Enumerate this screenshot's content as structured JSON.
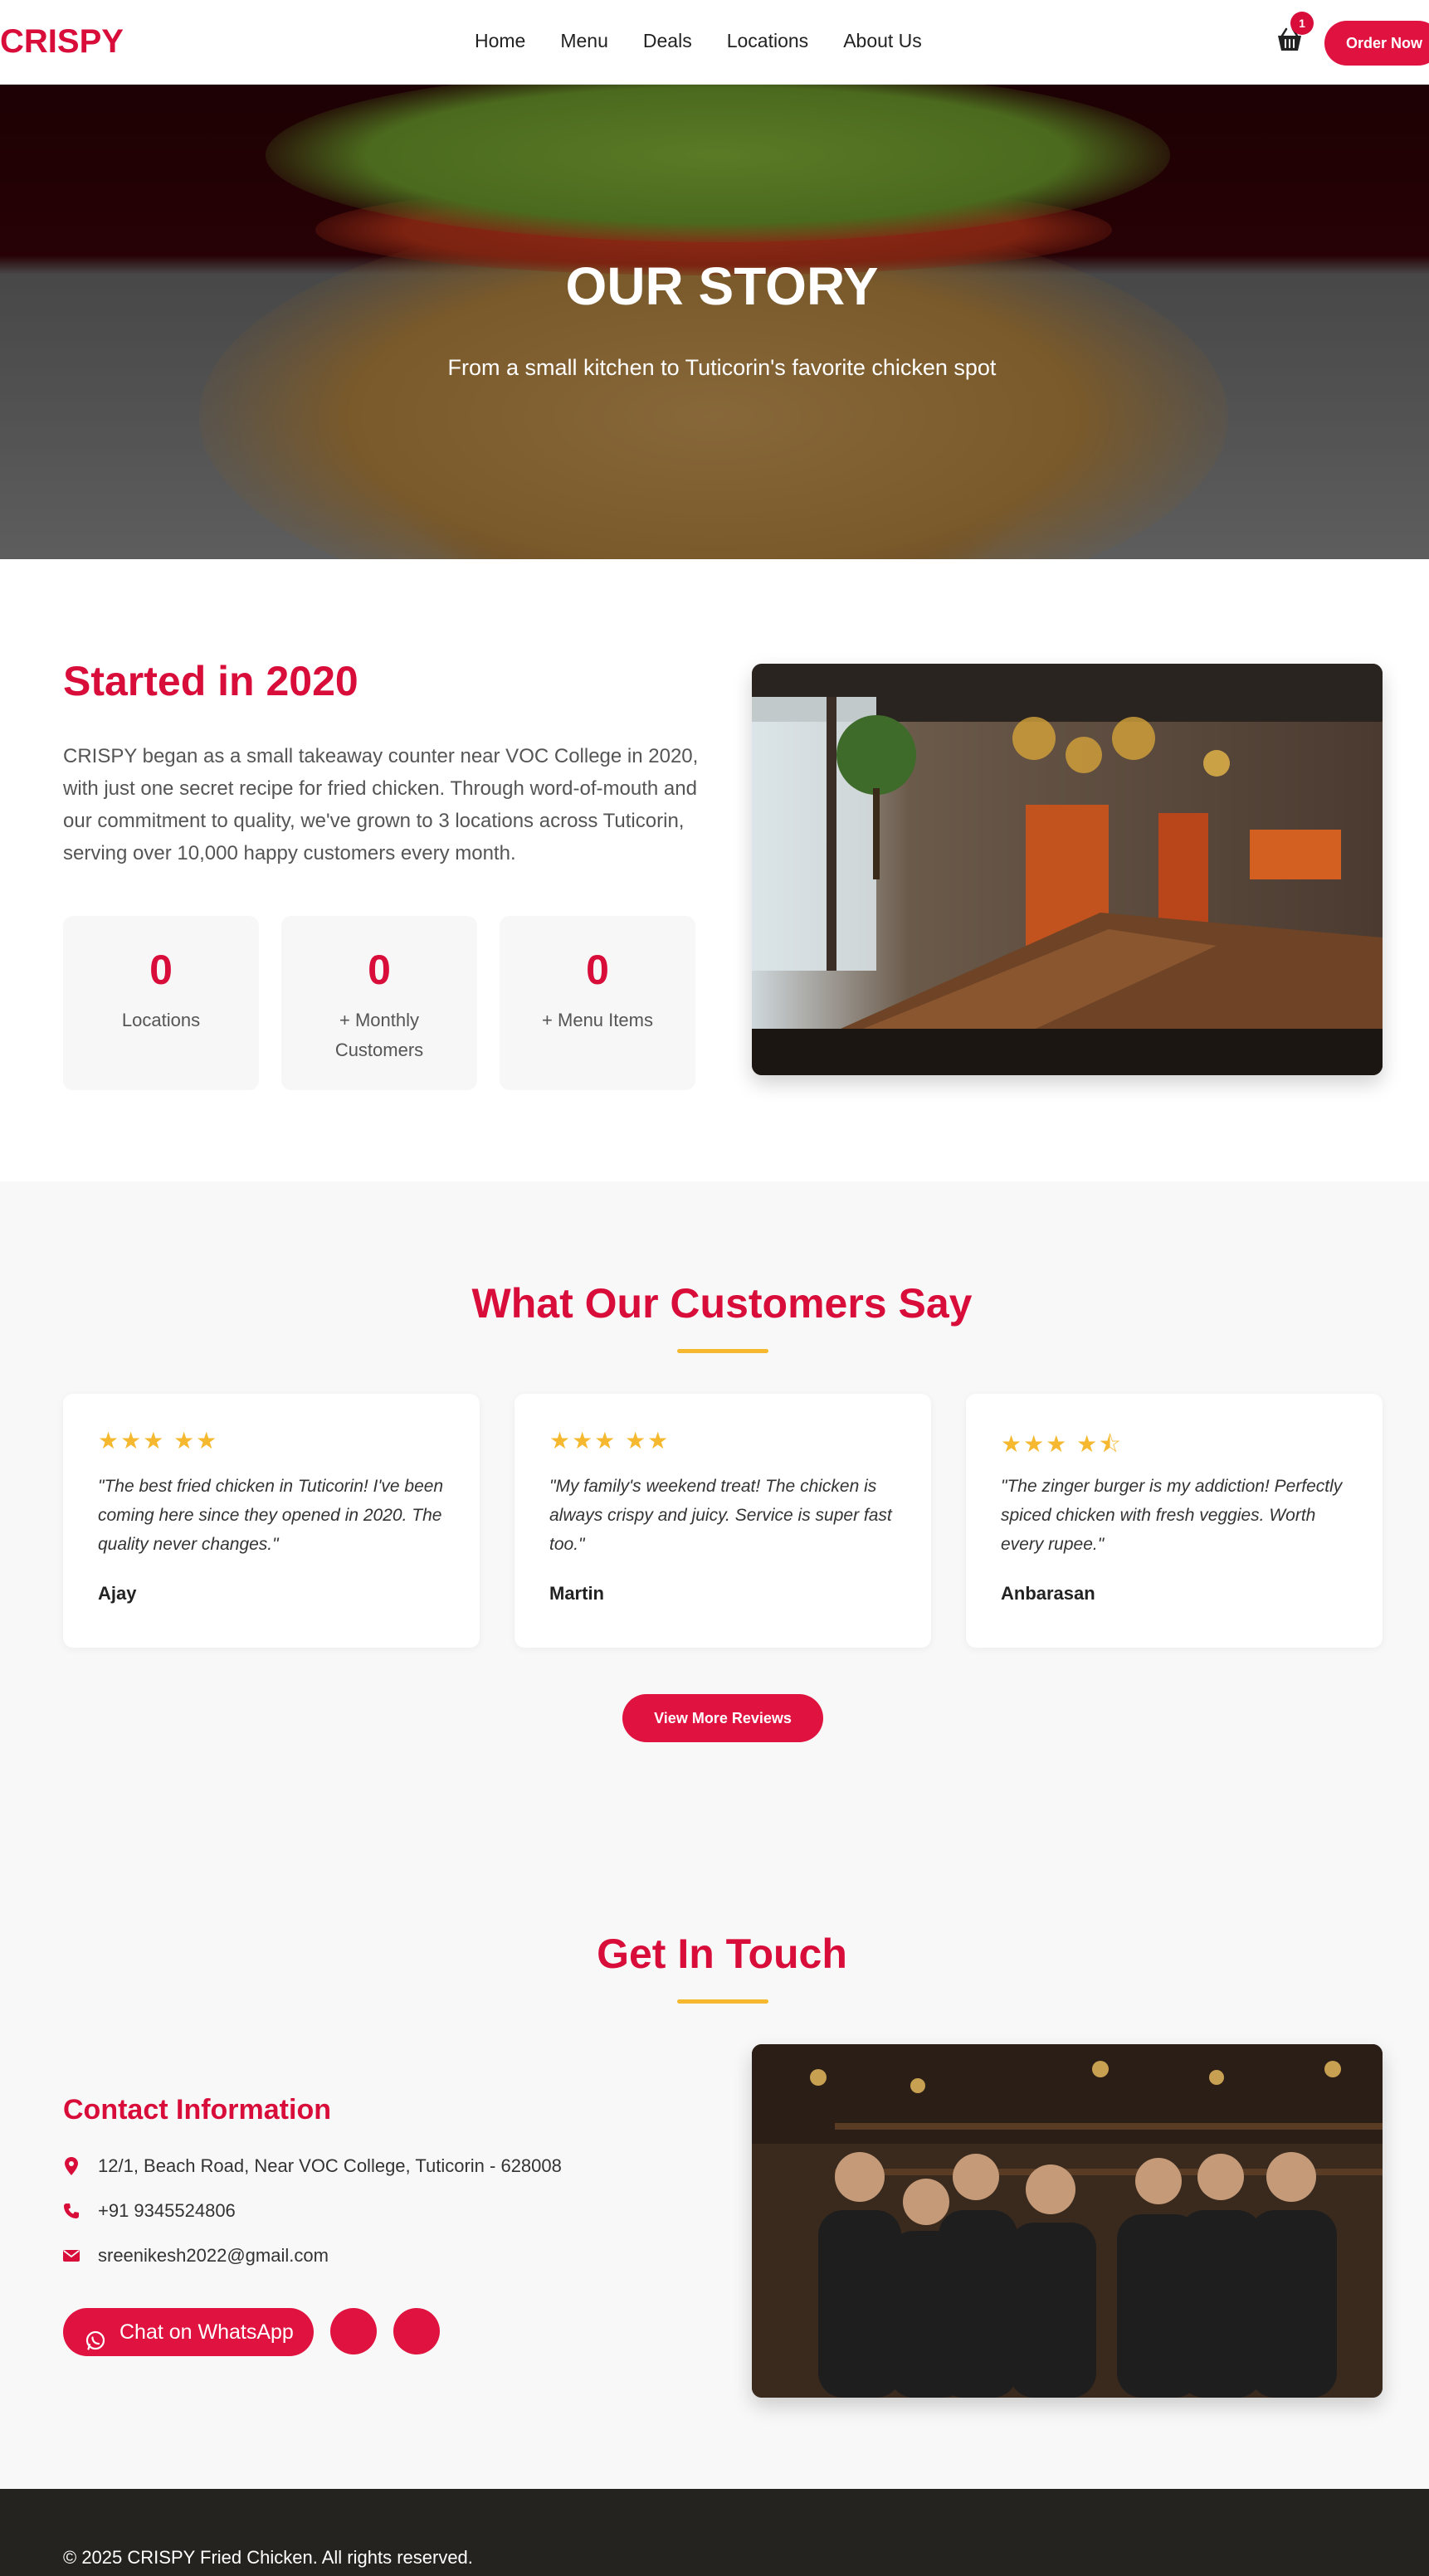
{
  "brand": {
    "logo": "CRISPY",
    "accent_color": "#d80d3a",
    "gold_color": "#f5b82e"
  },
  "nav": {
    "links": [
      "Home",
      "Menu",
      "Deals",
      "Locations",
      "About Us"
    ],
    "cart_count": "1",
    "cart_icon": "basket-icon",
    "order_button": "Order Now"
  },
  "hero": {
    "title": "OUR STORY",
    "subtitle": "From a small kitchen to Tuticorin's favorite chicken spot"
  },
  "story": {
    "title": "Started in 2020",
    "text": "CRISPY began as a small takeaway counter near VOC College in 2020, with just one secret recipe for fried chicken. Through word-of-mouth and our commitment to quality, we've grown to 3 locations across Tuticorin, serving over 10,000 happy customers every month.",
    "stats": [
      {
        "value": "0",
        "label": "Locations"
      },
      {
        "value": "0",
        "label": "+ Monthly Customers"
      },
      {
        "value": "0",
        "label": "+ Menu Items"
      }
    ]
  },
  "reviews": {
    "title": "What Our Customers Say",
    "items": [
      {
        "rating": 5,
        "stars": "★★★ ★★",
        "text": "\"The best fried chicken in Tuticorin! I've been coming here since they opened in 2020. The quality never changes.\"",
        "author": "Ajay"
      },
      {
        "rating": 5,
        "stars": "★★★ ★★",
        "text": "\"My family's weekend treat! The chicken is always crispy and juicy. Service is super fast too.\"",
        "author": "Martin"
      },
      {
        "rating": 4.5,
        "stars": "★★★ ★⯪",
        "text": "\"The zinger burger is my addiction! Perfectly spiced chicken with fresh veggies. Worth every rupee.\"",
        "author": "Anbarasan"
      }
    ],
    "more_button": "View More Reviews"
  },
  "contact": {
    "section_title": "Get In Touch",
    "info_title": "Contact Information",
    "address": "12/1, Beach Road, Near VOC College, Tuticorin - 628008",
    "phone": "+91 9345524806",
    "email": "sreenikesh2022@gmail.com",
    "whatsapp_button": "Chat on WhatsApp"
  },
  "footer": {
    "copyright": "© 2025 CRISPY Fried Chicken. All rights reserved."
  }
}
